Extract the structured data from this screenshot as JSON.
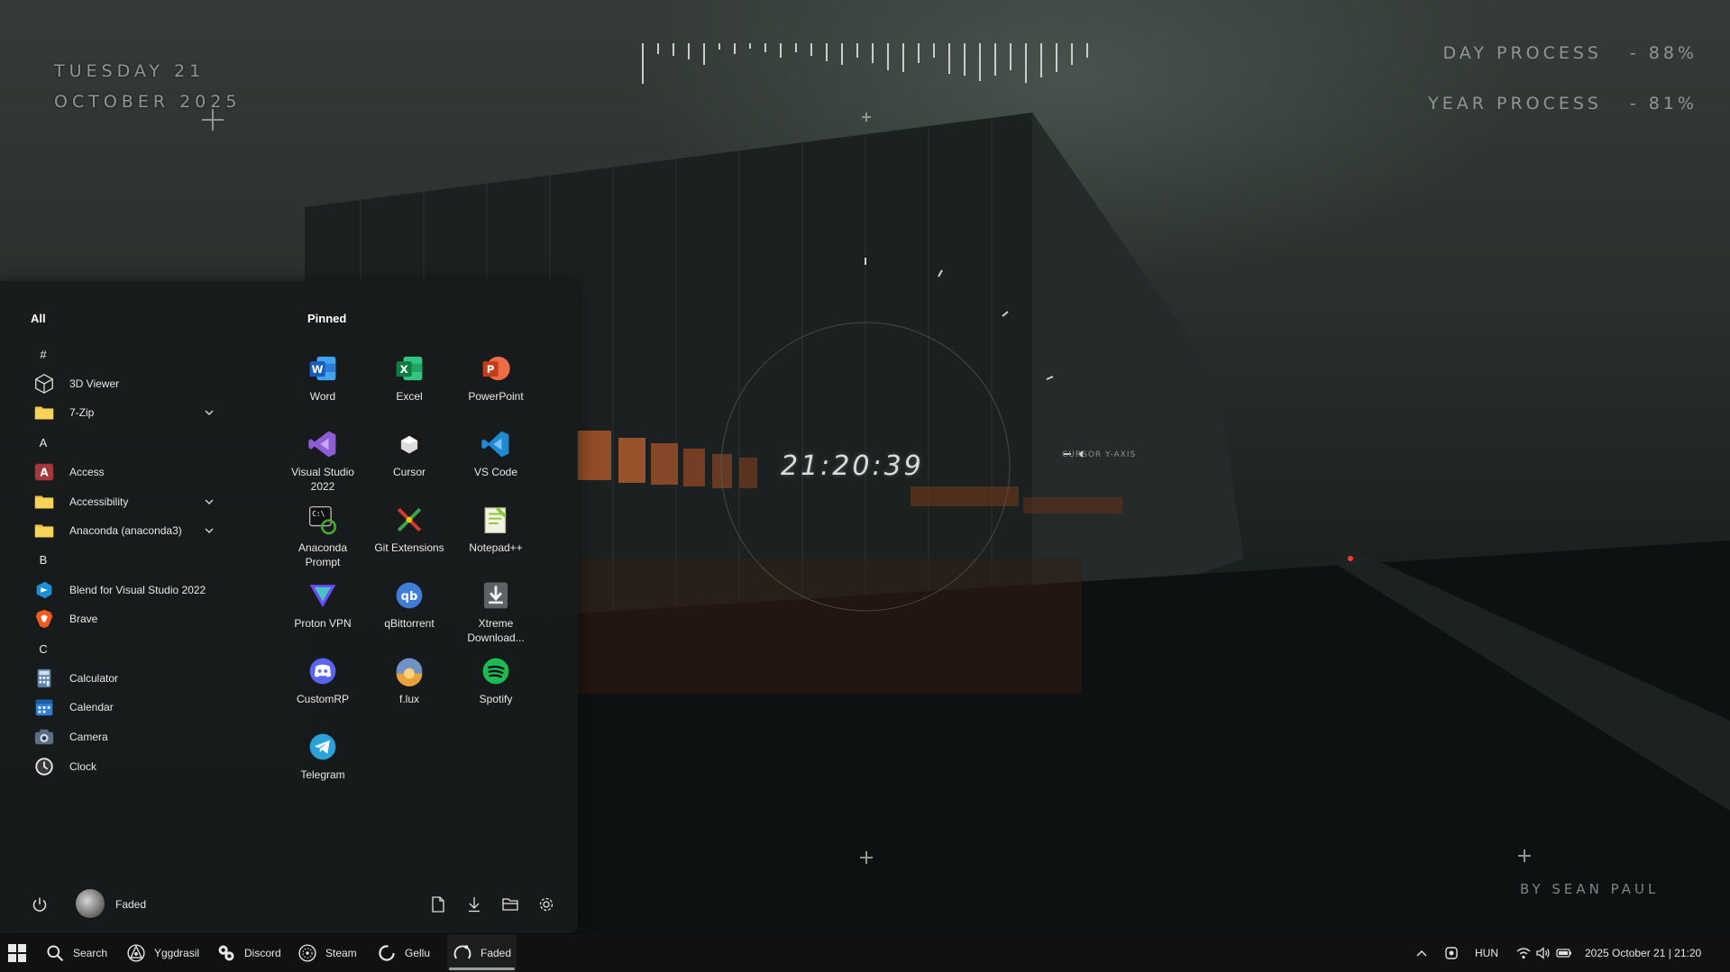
{
  "desktop": {
    "date_line1": "TUESDAY 21",
    "date_line2": "OCTOBER 2025",
    "day_process_label": "DAY PROCESS",
    "day_process_value": "- 88%",
    "year_process_label": "YEAR PROCESS",
    "year_process_value": "- 81%",
    "clock": "21:20:39",
    "cursor_label": "CURSOR Y-AXIS",
    "author": "BY SEAN PAUL",
    "day_progress": 0.88,
    "year_progress": 0.81
  },
  "start_menu": {
    "all_title": "All",
    "pinned_title": "Pinned",
    "all_list": [
      {
        "type": "letter",
        "label": "#"
      },
      {
        "type": "app",
        "label": "3D Viewer",
        "icon": "cube-icon",
        "expandable": false
      },
      {
        "type": "app",
        "label": "7-Zip",
        "icon": "folder-icon",
        "expandable": true
      },
      {
        "type": "letter",
        "label": "A"
      },
      {
        "type": "app",
        "label": "Access",
        "icon": "access-icon",
        "expandable": false
      },
      {
        "type": "app",
        "label": "Accessibility",
        "icon": "folder-icon",
        "expandable": true
      },
      {
        "type": "app",
        "label": "Anaconda (anaconda3)",
        "icon": "folder-icon",
        "expandable": true
      },
      {
        "type": "letter",
        "label": "B"
      },
      {
        "type": "app",
        "label": "Blend for Visual Studio 2022",
        "icon": "blend-icon",
        "expandable": false
      },
      {
        "type": "app",
        "label": "Brave",
        "icon": "brave-icon",
        "expandable": false
      },
      {
        "type": "letter",
        "label": "C"
      },
      {
        "type": "app",
        "label": "Calculator",
        "icon": "calculator-icon",
        "expandable": false
      },
      {
        "type": "app",
        "label": "Calendar",
        "icon": "calendar-icon",
        "expandable": false
      },
      {
        "type": "app",
        "label": "Camera",
        "icon": "camera-icon",
        "expandable": false
      },
      {
        "type": "app",
        "label": "Clock",
        "icon": "clock-icon",
        "expandable": false
      }
    ],
    "pinned": [
      {
        "label": "Word",
        "icon": "word-icon",
        "color": "#2b66c9"
      },
      {
        "label": "Excel",
        "icon": "excel-icon",
        "color": "#1e7b45"
      },
      {
        "label": "PowerPoint",
        "icon": "powerpoint-icon",
        "color": "#d24726"
      },
      {
        "label": "Visual Studio 2022",
        "icon": "visual-studio-icon",
        "color": "#8e5cd6"
      },
      {
        "label": "Cursor",
        "icon": "cursor-icon",
        "color": "#222222"
      },
      {
        "label": "VS Code",
        "icon": "vscode-icon",
        "color": "#1f8ad2"
      },
      {
        "label": "Anaconda Prompt",
        "icon": "anaconda-prompt-icon",
        "color": "#3a3a3a"
      },
      {
        "label": "Git Extensions",
        "icon": "git-extensions-icon",
        "color": "#d63a2a"
      },
      {
        "label": "Notepad++",
        "icon": "notepadpp-icon",
        "color": "#8cc63e"
      },
      {
        "label": "Proton VPN",
        "icon": "proton-vpn-icon",
        "color": "#6d4aff"
      },
      {
        "label": "qBittorrent",
        "icon": "qbittorrent-icon",
        "color": "#3f7dd8"
      },
      {
        "label": "Xtreme Download...",
        "icon": "xtreme-download-icon",
        "color": "#5a5a5a"
      },
      {
        "label": "CustomRP",
        "icon": "customrp-icon",
        "color": "#5865f2"
      },
      {
        "label": "f.lux",
        "icon": "flux-icon",
        "color": "#e8a23c"
      },
      {
        "label": "Spotify",
        "icon": "spotify-icon",
        "color": "#1db954"
      },
      {
        "label": "Telegram",
        "icon": "telegram-icon",
        "color": "#2aa1da"
      }
    ],
    "user_name": "Faded"
  },
  "taskbar": {
    "items": [
      {
        "label": "Search",
        "icon": "search-icon"
      },
      {
        "label": "Yggdrasil",
        "icon": "yggdrasil-icon"
      },
      {
        "label": "Discord",
        "icon": "discord-icon"
      },
      {
        "label": "Steam",
        "icon": "steam-icon"
      },
      {
        "label": "Gellu",
        "icon": "gellu-icon"
      },
      {
        "label": "Faded",
        "icon": "faded-icon"
      }
    ],
    "language": "HUN",
    "datetime": "2025 October 21  |  21:20"
  }
}
